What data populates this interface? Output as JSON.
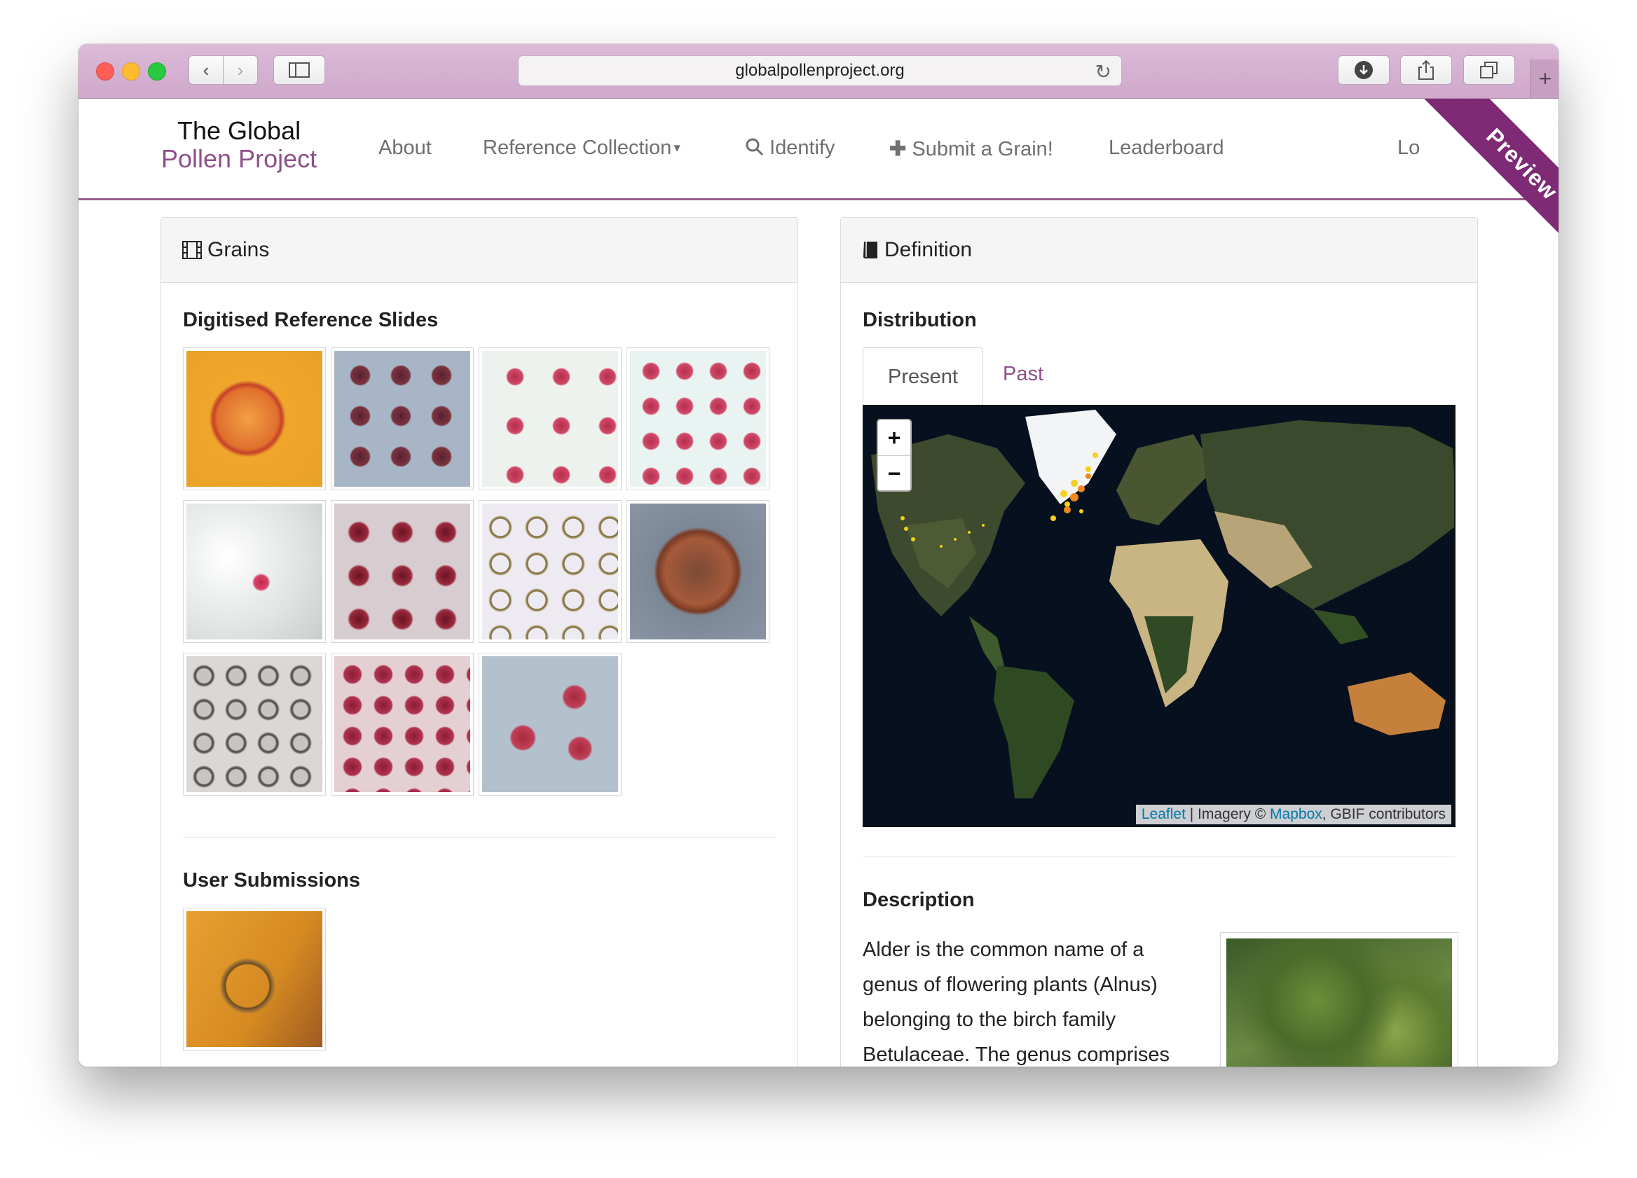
{
  "browser": {
    "url": "globalpollenproject.org"
  },
  "site": {
    "brand_line1": "The Global",
    "brand_line2": "Pollen Project",
    "nav": {
      "about": "About",
      "reference_collection": "Reference Collection",
      "identify": "Identify",
      "submit": "Submit a Grain!",
      "leaderboard": "Leaderboard",
      "login": "Lo"
    },
    "ribbon": "Preview"
  },
  "grains_panel": {
    "title": "Grains",
    "digitised_heading": "Digitised Reference Slides",
    "user_heading": "User Submissions"
  },
  "definition_panel": {
    "title": "Definition",
    "distribution_heading": "Distribution",
    "tabs": [
      "Present",
      "Past"
    ],
    "zoom_in": "+",
    "zoom_out": "−",
    "attribution": {
      "leaflet": "Leaflet",
      "imagery": " | Imagery © ",
      "mapbox": "Mapbox",
      "contrib": ", GBIF contributors"
    },
    "description_heading": "Description",
    "description_text": "Alder is the common name of a genus of flowering plants (Alnus) belonging to the birch family Betulaceae. The genus comprises"
  },
  "colors": {
    "brand_purple": "#8e4f8a",
    "ribbon": "#7e2a75",
    "link_blue": "#0078a8"
  }
}
